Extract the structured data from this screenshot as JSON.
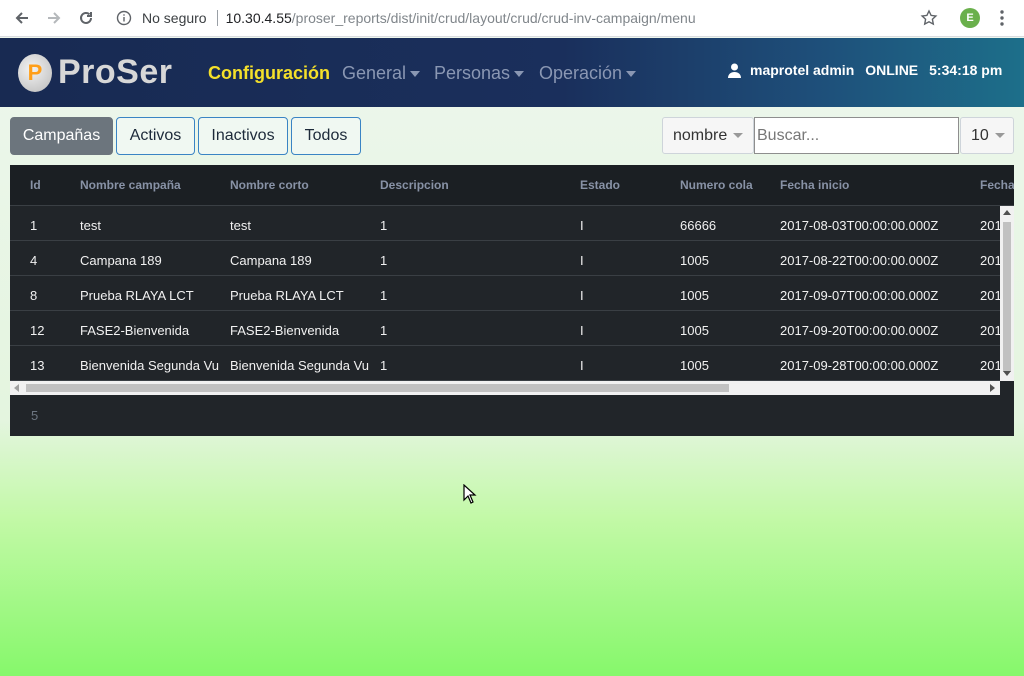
{
  "browser": {
    "security_label": "No seguro",
    "url_host": "10.30.4.55",
    "url_path": "/proser_reports/dist/init/crud/layout/crud/crud-inv-campaign/menu",
    "profile_initial": "E"
  },
  "app": {
    "logo_text": "ProSer",
    "menu": {
      "active": "Configuración",
      "items": [
        "General",
        "Personas",
        "Operación"
      ]
    },
    "user": {
      "name": "maprotel admin",
      "status": "ONLINE",
      "time": "5:34:18 pm"
    }
  },
  "filters": {
    "buttons": [
      "Campañas",
      "Activos",
      "Inactivos",
      "Todos"
    ],
    "active": "Campañas"
  },
  "search": {
    "field_selected": "nombre",
    "placeholder": "Buscar...",
    "page_size": "10"
  },
  "table": {
    "columns": [
      "Id",
      "Nombre campaña",
      "Nombre corto",
      "Descripcion",
      "Estado",
      "Numero cola",
      "Fecha inicio",
      "Fecha"
    ],
    "rows": [
      [
        "1",
        "test",
        "test",
        "1",
        "I",
        "66666",
        "2017-08-03T00:00:00.000Z",
        "201"
      ],
      [
        "4",
        "Campana 189",
        "Campana 189",
        "1",
        "I",
        "1005",
        "2017-08-22T00:00:00.000Z",
        "201"
      ],
      [
        "8",
        "Prueba RLAYA LCT",
        "Prueba RLAYA LCT",
        "1",
        "I",
        "1005",
        "2017-09-07T00:00:00.000Z",
        "201"
      ],
      [
        "12",
        "FASE2-Bienvenida",
        "FASE2-Bienvenida",
        "1",
        "I",
        "1005",
        "2017-09-20T00:00:00.000Z",
        "201"
      ],
      [
        "13",
        "Bienvenida Segunda Vu",
        "Bienvenida Segunda Vu",
        "1",
        "I",
        "1005",
        "2017-09-28T00:00:00.000Z",
        "201"
      ]
    ],
    "total_count": "5"
  },
  "colors": {
    "header_bg": "#182a52",
    "active_menu": "#f5e02a",
    "table_bg": "#212529",
    "active_filter": "#6c757d"
  }
}
